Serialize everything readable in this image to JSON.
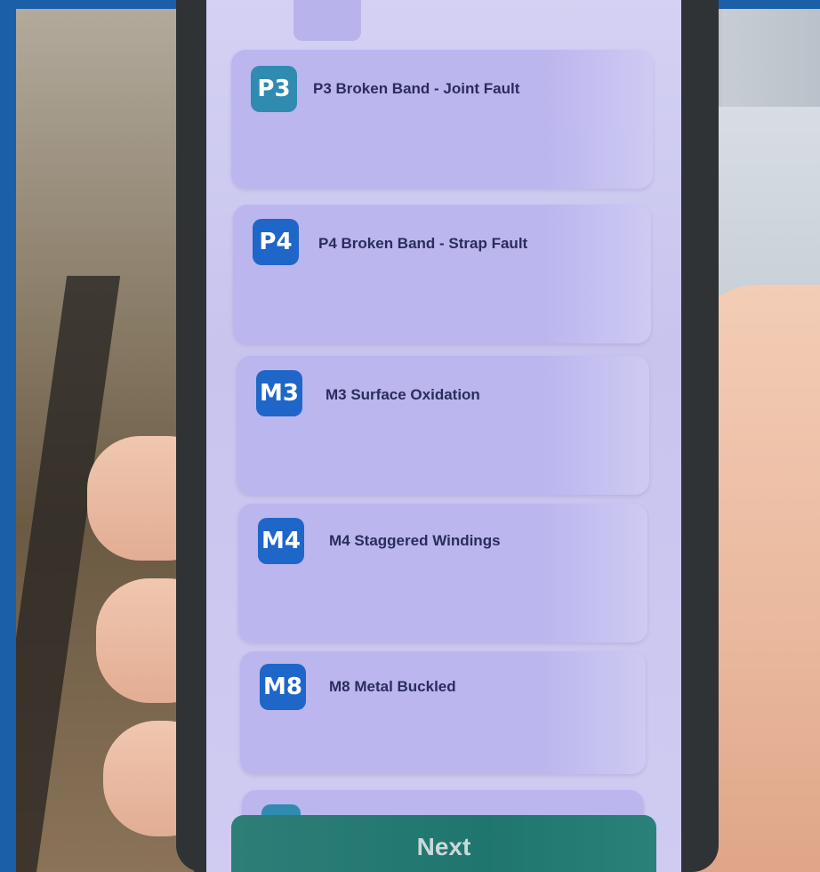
{
  "colors": {
    "frame": "#1a5fa8",
    "card_bg": "#bab4ee",
    "badge_teal": "#2f8bb0",
    "badge_blue": "#1f66c9",
    "next_button": "#20756f",
    "label_text": "#2a2d5c"
  },
  "list": {
    "items": [
      {
        "code": "P3",
        "label": "P3 Broken Band - Joint Fault",
        "badge_color": "#2f8bb0"
      },
      {
        "code": "P4",
        "label": "P4 Broken Band - Strap Fault",
        "badge_color": "#1f66c9"
      },
      {
        "code": "M3",
        "label": "M3 Surface Oxidation",
        "badge_color": "#1f66c9"
      },
      {
        "code": "M4",
        "label": "M4 Staggered Windings",
        "badge_color": "#1f66c9"
      },
      {
        "code": "M8",
        "label": "M8 Metal Buckled",
        "badge_color": "#1f66c9"
      }
    ]
  },
  "footer": {
    "next_label": "Next"
  }
}
